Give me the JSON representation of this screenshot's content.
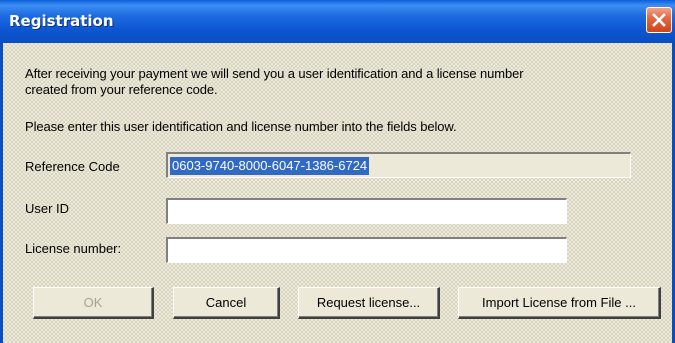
{
  "window": {
    "title": "Registration",
    "close_icon": "close-icon",
    "accent": "#0b4cc0",
    "close_color": "#d9532d"
  },
  "message": {
    "line1": "After receiving your payment we will send you a user identification and a license number",
    "line2": "created from your reference code.",
    "line3": "Please enter this user identification and license number into the fields below."
  },
  "fields": {
    "reference_label": "Reference Code",
    "reference_value": "0603-9740-8000-6047-1386-6724",
    "userid_label": "User ID",
    "userid_value": "",
    "license_label": "License number:",
    "license_value": ""
  },
  "buttons": {
    "ok": "OK",
    "cancel": "Cancel",
    "request": "Request license...",
    "import": "Import License from File ..."
  }
}
